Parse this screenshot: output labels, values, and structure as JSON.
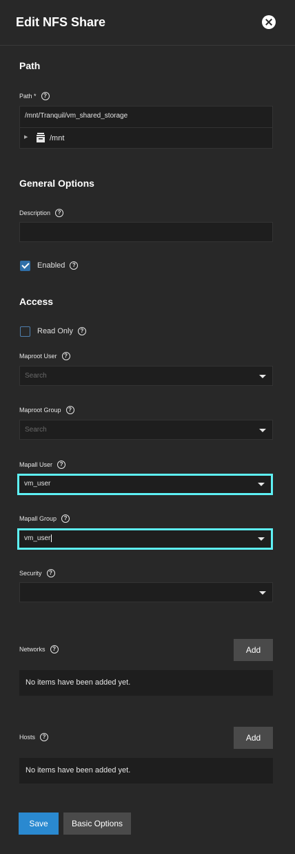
{
  "dialog": {
    "title": "Edit NFS Share"
  },
  "path_section": {
    "title": "Path",
    "path_label": "Path *",
    "path_value": "/mnt/Tranquil/vm_shared_storage",
    "tree_node": "/mnt"
  },
  "general": {
    "title": "General Options",
    "description_label": "Description",
    "description_value": "",
    "enabled_label": "Enabled",
    "enabled_checked": true
  },
  "access": {
    "title": "Access",
    "read_only_label": "Read Only",
    "read_only_checked": false,
    "maproot_user_label": "Maproot User",
    "maproot_user_placeholder": "Search",
    "maproot_group_label": "Maproot Group",
    "maproot_group_placeholder": "Search",
    "mapall_user_label": "Mapall User",
    "mapall_user_value": "vm_user",
    "mapall_group_label": "Mapall Group",
    "mapall_group_value": "vm_user",
    "security_label": "Security",
    "security_value": ""
  },
  "networks": {
    "label": "Networks",
    "add_label": "Add",
    "empty_text": "No items have been added yet."
  },
  "hosts": {
    "label": "Hosts",
    "add_label": "Add",
    "empty_text": "No items have been added yet."
  },
  "actions": {
    "save_label": "Save",
    "basic_options_label": "Basic Options"
  },
  "icons": {
    "help": "?"
  },
  "colors": {
    "accent": "#2a89d0",
    "focus": "#5ef1f5",
    "background": "#282828"
  }
}
